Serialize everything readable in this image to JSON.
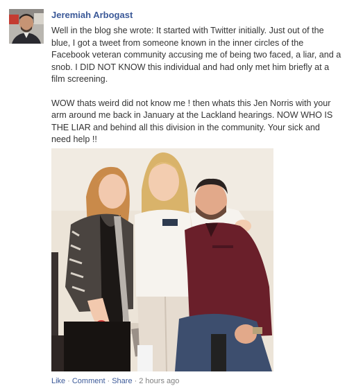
{
  "post": {
    "author": "Jeremiah Arbogast",
    "paragraphs": [
      "Well in the blog she wrote: It started with Twitter initially. Just out of the blue, I got a tweet from someone known in the inner circles of the Facebook veteran community accusing me of being two faced, a liar, and a snob. I DID NOT KNOW this individual and had only met him briefly at a film screening.",
      "WOW thats weird did not know me ! then whats this Jen Norris with your arm around me back in January at the Lackland hearings. NOW WHO IS THE LIAR and behind all this division in the community. Your sick and need help !!"
    ],
    "photo_icon": "photo-three-people",
    "actions": {
      "like": "Like",
      "comment": "Comment",
      "share": "Share",
      "separator": "·",
      "time": "2 hours ago"
    }
  },
  "colors": {
    "link": "#3b5998",
    "text": "#333333",
    "meta": "#808080"
  }
}
